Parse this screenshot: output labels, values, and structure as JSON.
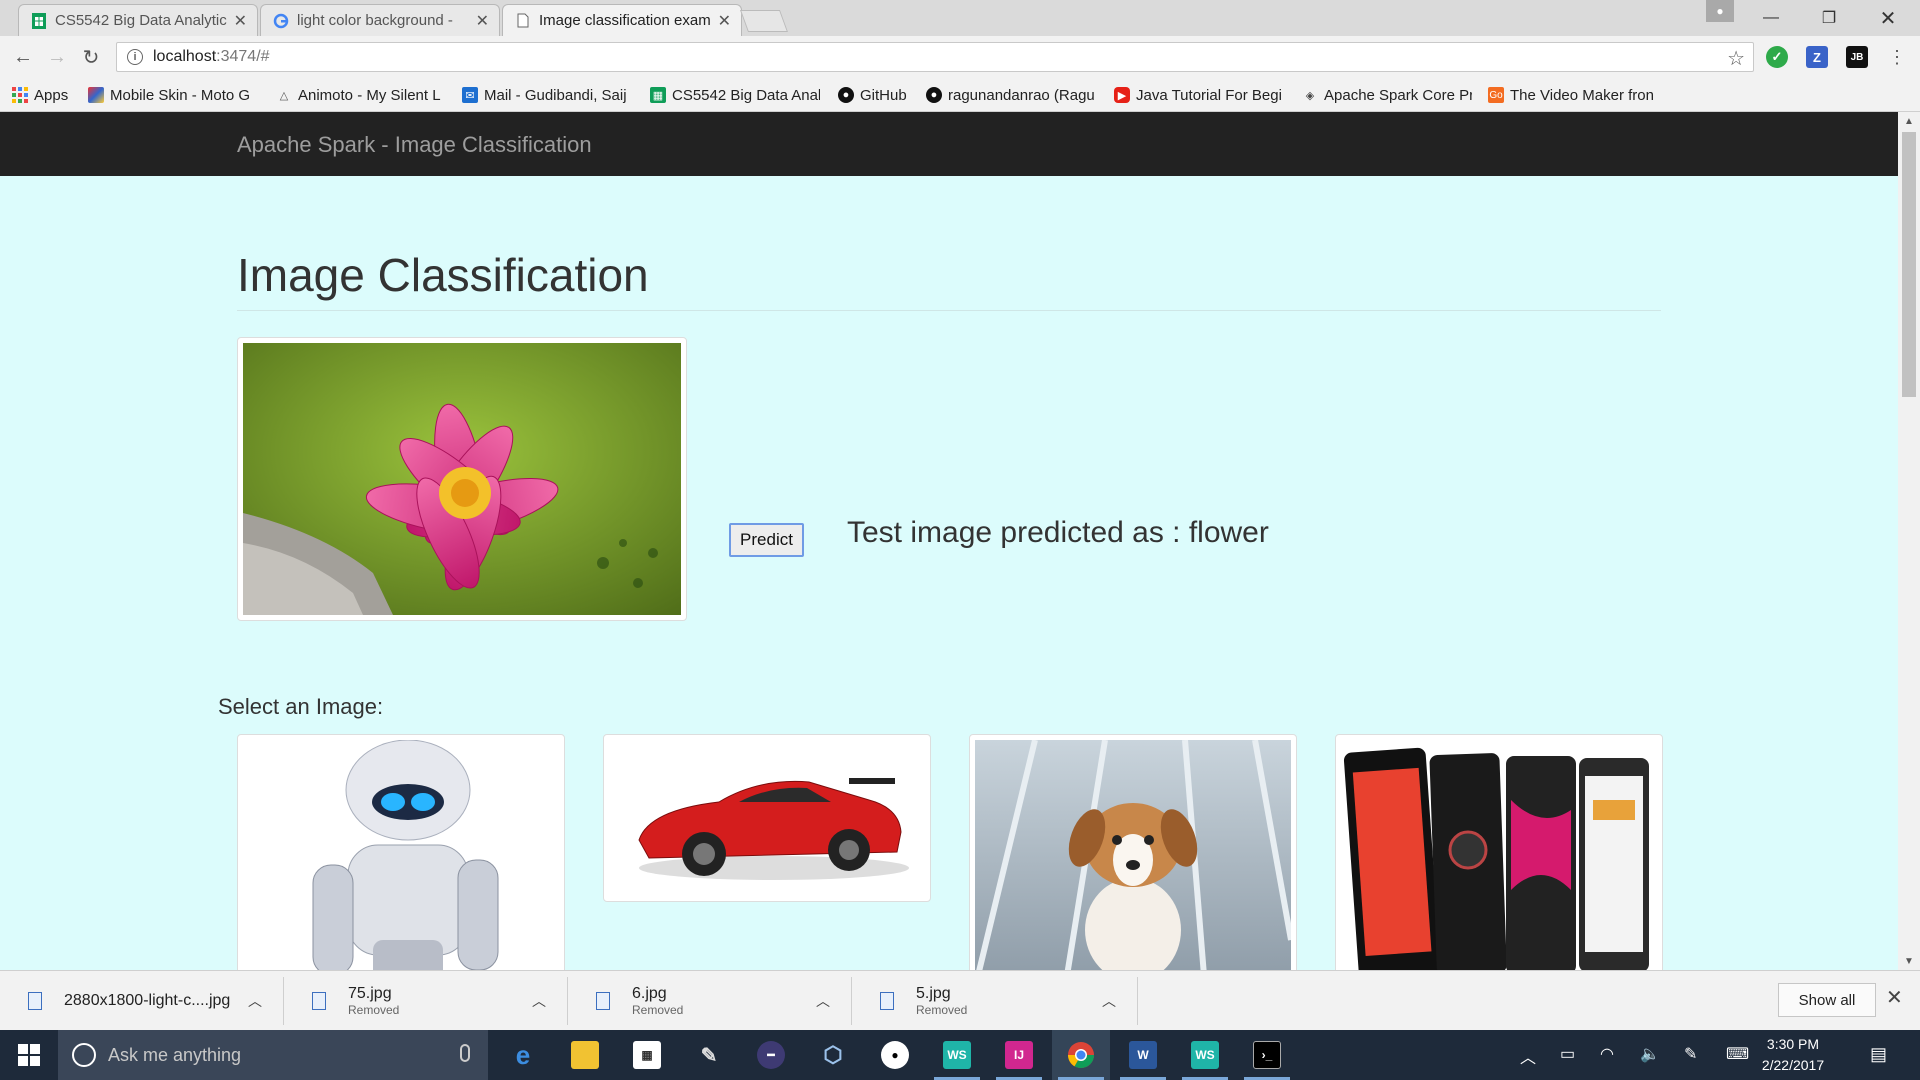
{
  "browser": {
    "tabs": [
      {
        "title": "CS5542 Big Data Analytic",
        "icon": "sheets-icon"
      },
      {
        "title": "light color background -",
        "icon": "google-icon"
      },
      {
        "title": "Image classification exam",
        "icon": "page-icon"
      }
    ],
    "url_host": "localhost",
    "url_path": ":3474/#",
    "bookmarks": [
      "Apps",
      "Mobile Skin - Moto G",
      "Animoto - My Silent L",
      "Mail - Gudibandi, Saij",
      "CS5542 Big Data Anal",
      "GitHub",
      "ragunandanrao (Ragu",
      "Java Tutorial For Begi",
      "Apache Spark Core Pr",
      "The Video Maker fron"
    ]
  },
  "page": {
    "brand": "Apache Spark - Image Classification",
    "heading": "Image Classification",
    "predict_label": "Predict",
    "result_text": "Test image predicted as : flower",
    "select_label": "Select an Image:",
    "test_image": "water lily flower photo",
    "gallery": [
      "robot",
      "red sports car",
      "puppy",
      "smartphones"
    ]
  },
  "downloads": {
    "items": [
      {
        "name": "2880x1800-light-c....jpg",
        "status": ""
      },
      {
        "name": "75.jpg",
        "status": "Removed"
      },
      {
        "name": "6.jpg",
        "status": "Removed"
      },
      {
        "name": "5.jpg",
        "status": "Removed"
      }
    ],
    "show_all": "Show all"
  },
  "taskbar": {
    "search_placeholder": "Ask me anything",
    "time": "3:30 PM",
    "date": "2/22/2017"
  },
  "colors": {
    "page_bg": "#dcfcfc",
    "navbar_bg": "#222222",
    "brand_text": "#9d9d9d"
  }
}
